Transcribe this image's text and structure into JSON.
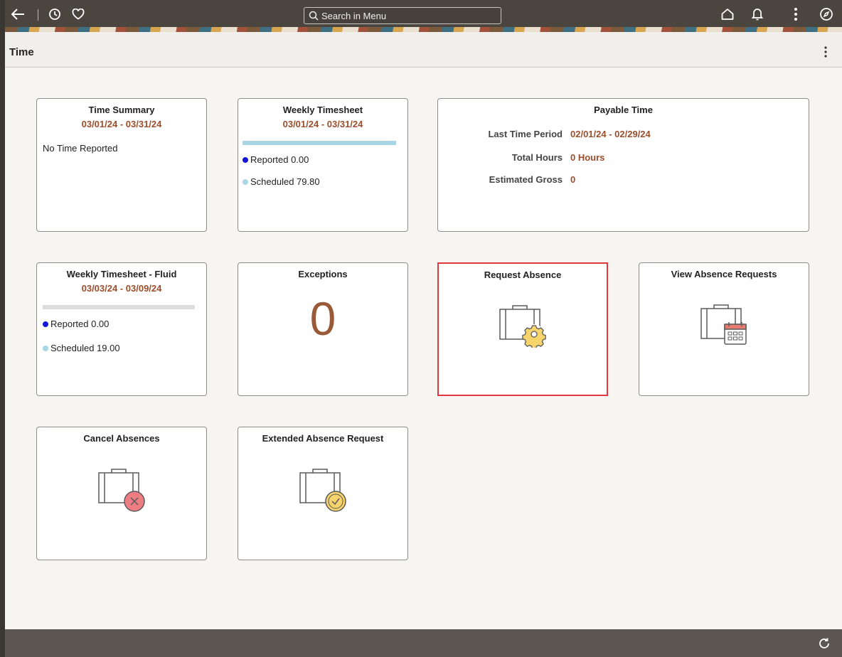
{
  "header": {
    "search_placeholder": "Search in Menu",
    "icons": [
      "back-arrow-icon",
      "history-icon",
      "favorites-heart-icon",
      "home-icon",
      "notification-bell-icon",
      "more-vertical-icon",
      "navbar-compass-icon"
    ]
  },
  "page": {
    "title": "Time"
  },
  "tiles": {
    "time_summary": {
      "title": "Time Summary",
      "date": "03/01/24 - 03/31/24",
      "text": "No Time Reported"
    },
    "weekly_timesheet": {
      "title": "Weekly Timesheet",
      "date": "03/01/24 - 03/31/24",
      "reported": "Reported 0.00",
      "scheduled": "Scheduled 79.80"
    },
    "payable_time": {
      "title": "Payable Time",
      "rows": [
        {
          "label": "Last Time Period",
          "value": "02/01/24 - 02/29/24"
        },
        {
          "label": "Total Hours",
          "value": "0 Hours"
        },
        {
          "label": "Estimated Gross",
          "value": "0"
        }
      ]
    },
    "weekly_timesheet_fluid": {
      "title": "Weekly Timesheet - Fluid",
      "date": "03/03/24 - 03/09/24",
      "reported": "Reported 0.00",
      "scheduled": "Scheduled 19.00"
    },
    "exceptions": {
      "title": "Exceptions",
      "count": "0"
    },
    "request_absence": {
      "title": "Request Absence"
    },
    "view_absence_requests": {
      "title": "View Absence Requests"
    },
    "cancel_absences": {
      "title": "Cancel Absences"
    },
    "extended_absence_request": {
      "title": "Extended Absence Request"
    }
  },
  "colors": {
    "accent_date": "#9a4f2c",
    "reported_dot": "#1515d8",
    "scheduled_dot": "#a9d6e5",
    "selected_border": "#e0383e"
  }
}
